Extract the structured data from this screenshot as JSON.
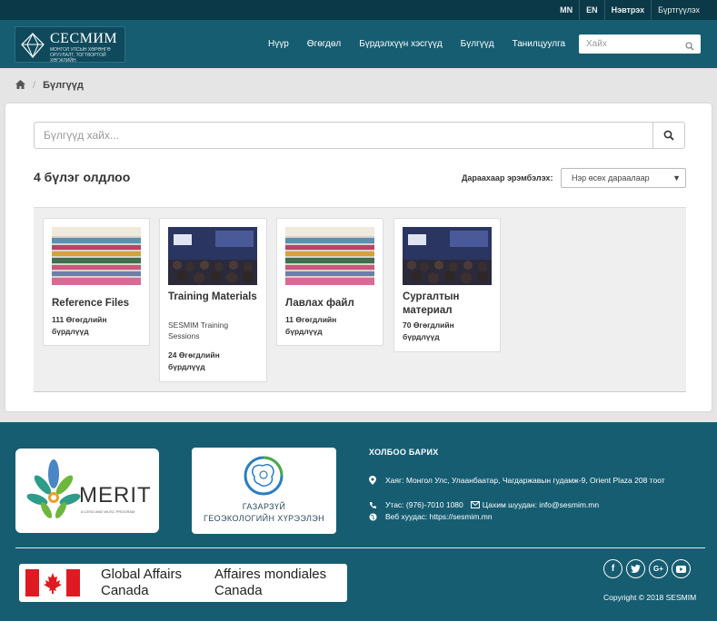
{
  "topbar": {
    "lang_mn": "MN",
    "lang_en": "EN",
    "login": "Нэвтрэх",
    "register": "Бүртгүүлэх"
  },
  "logo": {
    "title": "СЕСМИМ",
    "subtitle": "МОНГОЛ УЛСЫН ХӨРӨНГӨ ОРУУЛАЛТ, ТОГТВОРТОЙ ХӨГЖЛИЙН"
  },
  "nav": {
    "items": [
      {
        "label": "Нүүр"
      },
      {
        "label": "Өгөгдөл"
      },
      {
        "label": "Бүрдэлхүүн хэсгүүд"
      },
      {
        "label": "Бүлгүүд"
      },
      {
        "label": "Танилцуулга"
      }
    ],
    "search_placeholder": "Хайх",
    "search_icon": "search-icon"
  },
  "breadcrumb": {
    "home_icon": "home-icon",
    "separator": "/",
    "current": "Бүлгүүд"
  },
  "main": {
    "search_placeholder": "Бүлгүүд хайх...",
    "found_text": "4 бүлэг олдлоо",
    "sort_label": "Дараахаар эрэмбэлэх:",
    "sort_value": "Нэр өсөх дараалаар",
    "groups": [
      {
        "title": "Reference Files",
        "desc": "",
        "count": "111 Өгөгдлийн бүрдлүүд"
      },
      {
        "title": "Training Materials",
        "desc": "SESMIM Training Sessions",
        "count": "24 Өгөгдлийн бүрдлүүд"
      },
      {
        "title": "Лавлах файл",
        "desc": "",
        "count": "11 Өгөгдлийн бүрдлүүд"
      },
      {
        "title": "Сургалтын материал",
        "desc": "",
        "count": "70 Өгөгдлийн бүрдлүүд"
      }
    ]
  },
  "footer": {
    "merit_logo": "MERIT",
    "merit_sub": "A CESO AND WUSC PROGRAM",
    "geo_line1": "ГАЗАРЗҮЙ",
    "geo_line2": "ГЕОЭКОЛОГИЙН ХҮРЭЭЛЭН",
    "contact_heading": "ХОЛБОО БАРИХ",
    "address": "Хаяг: Монгол Улс, Улаанбаатар, Чагдаржавын гудамж-9, Orient Plaza 208 тоот",
    "phone": "Утас: (976)-7010 1080",
    "email": "Цахим шуудан: info@sesmim.mn",
    "web": "Веб хуудас: https://sesmim.mn",
    "gac_en1": "Global Affairs",
    "gac_en2": "Canada",
    "gac_fr1": "Affaires mondiales",
    "gac_fr2": "Canada",
    "social": [
      "facebook-icon",
      "twitter-icon",
      "google-plus-icon",
      "youtube-icon"
    ],
    "copyright": "Copyright © 2018 SESMIM"
  },
  "colors": {
    "topbar": "#0c3947",
    "navbar": "#165d72",
    "footer": "#165d72"
  }
}
